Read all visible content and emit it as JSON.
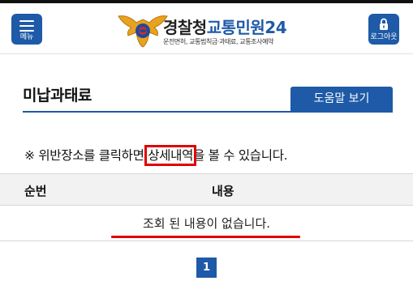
{
  "header": {
    "menu_label": "메뉴",
    "logout_label": "로그아웃",
    "brand_main": "경찰청",
    "brand_accent": "교통민원24",
    "brand_sub": "운전면허, 교통범칙금·과태료, 교통조사예약"
  },
  "main": {
    "title": "미납과태료",
    "help_button": "도움말 보기",
    "notice_prefix": "※ 위반장소를 클릭하면 ",
    "notice_highlight": "상세내역",
    "notice_suffix": "을 볼 수 있습니다.",
    "table": {
      "columns": [
        "순번",
        "내용"
      ],
      "empty_message": "조회 된 내용이 없습니다."
    },
    "pagination": {
      "current_page": "1"
    }
  },
  "colors": {
    "brand_blue": "#1e5aa7",
    "annotation_red": "#e00000"
  },
  "icons": [
    "hamburger-icon",
    "lock-icon",
    "police-emblem-logo"
  ]
}
